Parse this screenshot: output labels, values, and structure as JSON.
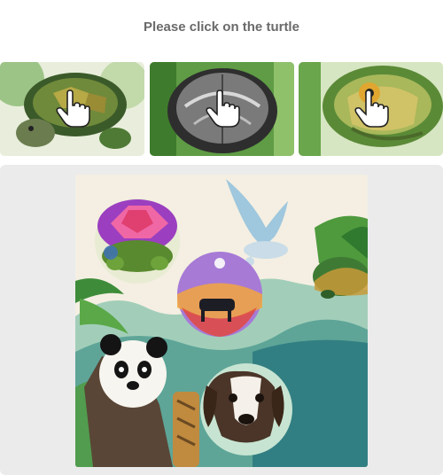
{
  "captcha": {
    "prompt": "Please click on the turtle",
    "examples": [
      {
        "subject": "turtle",
        "icon": "hand-pointer-icon"
      },
      {
        "subject": "turtle",
        "icon": "hand-pointer-icon"
      },
      {
        "subject": "turtle",
        "icon": "hand-pointer-icon"
      }
    ],
    "scene_items": [
      "turtle",
      "bird",
      "bubble",
      "sea-turtle",
      "panda",
      "dog"
    ]
  }
}
